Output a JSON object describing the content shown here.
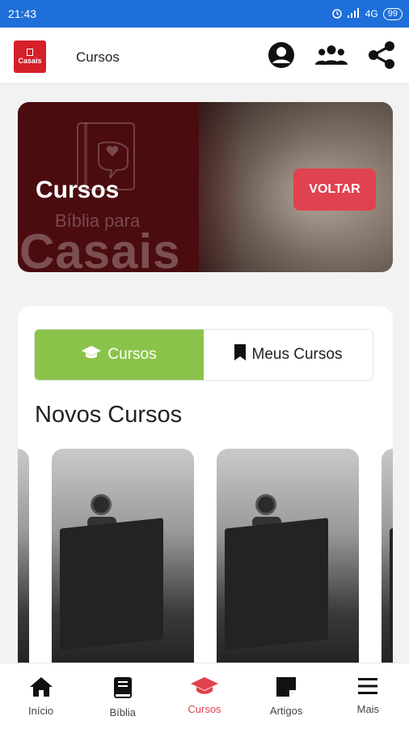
{
  "status_bar": {
    "time": "21:43",
    "network": "4G",
    "battery": "99"
  },
  "app_bar": {
    "logo_text": "Casais",
    "title": "Cursos",
    "icons": [
      "account-circle-icon",
      "group-icon",
      "share-icon"
    ]
  },
  "hero": {
    "title": "Cursos",
    "button_label": "VOLTAR",
    "watermark_word": "Casais",
    "watermark_sub": "Bíblia para"
  },
  "tabs": [
    {
      "label": "Cursos",
      "icon": "graduation-cap-icon",
      "active": true
    },
    {
      "label": "Meus Cursos",
      "icon": "bookmark-icon",
      "active": false
    }
  ],
  "section_title": "Novos Cursos",
  "bottom_nav": [
    {
      "label": "Início",
      "icon": "home-icon",
      "active": false
    },
    {
      "label": "Bíblia",
      "icon": "book-icon",
      "active": false
    },
    {
      "label": "Cursos",
      "icon": "graduation-cap-icon",
      "active": true
    },
    {
      "label": "Artigos",
      "icon": "note-icon",
      "active": false
    },
    {
      "label": "Mais",
      "icon": "menu-icon",
      "active": false
    }
  ],
  "colors": {
    "status_bar": "#1e6fd9",
    "accent_red": "#e0424f",
    "tab_active_green": "#8bc34a",
    "brand_red": "#d5202a"
  }
}
